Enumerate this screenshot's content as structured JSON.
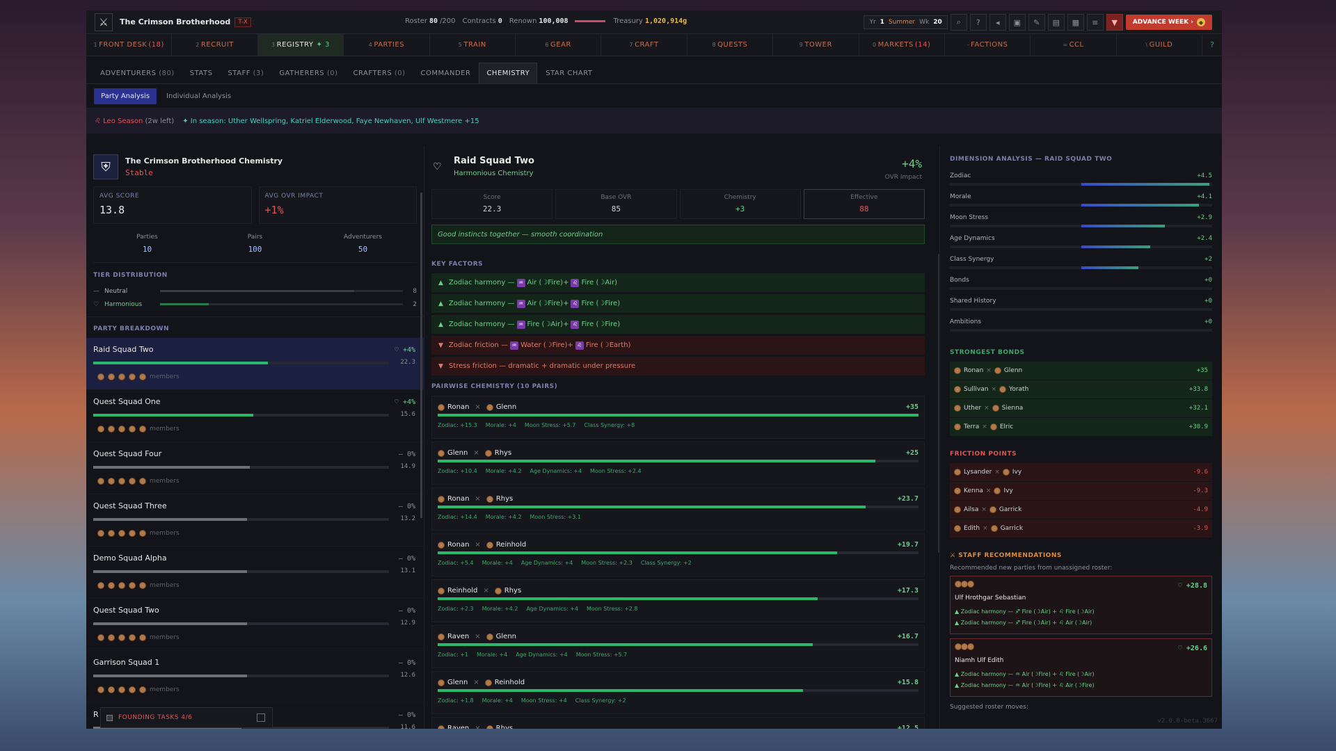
{
  "header": {
    "title": "The Crimson Brotherhood",
    "tag": "T-X",
    "roster_label": "Roster",
    "roster": "80",
    "roster_max": "/200",
    "contracts_label": "Contracts",
    "contracts": "0",
    "renown_label": "Renown",
    "renown": "100,008",
    "treasury_label": "Treasury",
    "treasury": "1,020,914g",
    "yr_label": "Yr",
    "yr": "1",
    "season": "Summer",
    "wk_label": "Wk",
    "wk": "20",
    "advance": "ADVANCE WEEK ›"
  },
  "nav": [
    {
      "n": "1",
      "label": "FRONT DESK",
      "count": "(18)"
    },
    {
      "n": "2",
      "label": "RECRUIT"
    },
    {
      "n": "3",
      "label": "REGISTRY",
      "acc": "✦ 3",
      "active": true
    },
    {
      "n": "4",
      "label": "PARTIES"
    },
    {
      "n": "5",
      "label": "TRAIN"
    },
    {
      "n": "6",
      "label": "GEAR"
    },
    {
      "n": "7",
      "label": "CRAFT"
    },
    {
      "n": "8",
      "label": "QUESTS"
    },
    {
      "n": "9",
      "label": "TOWER"
    },
    {
      "n": "0",
      "label": "MARKETS",
      "count": "(14)"
    },
    {
      "n": "-",
      "label": "FACTIONS"
    },
    {
      "n": "=",
      "label": "CCL"
    },
    {
      "n": "\\",
      "label": "GUILD"
    }
  ],
  "subtabs": [
    {
      "label": "ADVENTURERS",
      "c": "(80)"
    },
    {
      "label": "STATS"
    },
    {
      "label": "STAFF",
      "c": "(3)"
    },
    {
      "label": "GATHERERS",
      "c": "(0)"
    },
    {
      "label": "CRAFTERS",
      "c": "(0)"
    },
    {
      "label": "COMMANDER"
    },
    {
      "label": "CHEMISTRY",
      "active": true
    },
    {
      "label": "STAR CHART"
    }
  ],
  "modes": [
    "Party Analysis",
    "Individual Analysis"
  ],
  "season_bar": {
    "leo": "Leo Season",
    "left": "(2w left)",
    "in_season": "✦ In season: Uther Wellspring, Katriel Elderwood, Faye Newhaven, Ulf Westmere +15"
  },
  "summary": {
    "title": "The Crimson Brotherhood Chemistry",
    "status": "Stable",
    "avg_score_label": "AVG SCORE",
    "avg_score": "13.8",
    "avg_ovr_label": "AVG OVR IMPACT",
    "avg_ovr": "+1%",
    "parties_label": "Parties",
    "parties": "10",
    "pairs_label": "Pairs",
    "pairs": "100",
    "adventurers_label": "Adventurers",
    "adventurers": "50"
  },
  "tier": {
    "header": "TIER DISTRIBUTION",
    "rows": [
      {
        "name": "Neutral",
        "count": "8",
        "frac": 0.8
      },
      {
        "name": "Harmonious",
        "count": "2",
        "frac": 0.2
      }
    ]
  },
  "breakdown": {
    "header": "PARTY BREAKDOWN",
    "members": "members",
    "parties": [
      {
        "name": "Raid Squad Two",
        "impact": "+4%",
        "score": "22.3",
        "frac": 0.59,
        "good": true
      },
      {
        "name": "Quest Squad One",
        "impact": "+4%",
        "score": "15.6",
        "frac": 0.54,
        "good": true
      },
      {
        "name": "Quest Squad Four",
        "impact": "— 0%",
        "score": "14.9",
        "frac": 0.53
      },
      {
        "name": "Quest Squad Three",
        "impact": "— 0%",
        "score": "13.2",
        "frac": 0.52
      },
      {
        "name": "Demo Squad Alpha",
        "impact": "— 0%",
        "score": "13.1",
        "frac": 0.52
      },
      {
        "name": "Quest Squad Two",
        "impact": "— 0%",
        "score": "12.9",
        "frac": 0.52
      },
      {
        "name": "Garrison Squad 1",
        "impact": "— 0%",
        "score": "12.6",
        "frac": 0.52
      },
      {
        "name": "R",
        "impact": "— 0%",
        "score": "11.6",
        "frac": 0.5
      }
    ]
  },
  "founding": "FOUNDING TASKS 4/6",
  "detail": {
    "title": "Raid Squad Two",
    "sub": "Harmonious Chemistry",
    "impact": "+4%",
    "impact_label": "OVR Impact",
    "score_label": "Score",
    "score": "22.3",
    "base_label": "Base OVR",
    "base": "85",
    "chem_label": "Chemistry",
    "chem": "+3",
    "eff_label": "Effective",
    "eff": "88",
    "quote": "Good instincts together — smooth coordination",
    "kf_header": "KEY FACTORS",
    "pair_header": "PAIRWISE CHEMISTRY (10 PAIRS)"
  },
  "key_factors": [
    {
      "up": true,
      "pre": "Zodiac harmony —",
      "a": "Air (☽Fire)",
      "b": "Fire (☽Air)"
    },
    {
      "up": true,
      "pre": "Zodiac harmony —",
      "a": "Air (☽Fire)",
      "b": "Fire (☽Fire)"
    },
    {
      "up": true,
      "pre": "Zodiac harmony —",
      "a": "Fire (☽Air)",
      "b": "Fire (☽Fire)"
    },
    {
      "up": false,
      "pre": "Zodiac friction —",
      "a": "Water (☽Fire)",
      "b": "Fire (☽Earth)"
    },
    {
      "up": false,
      "pre": "Stress friction — dramatic + dramatic under pressure",
      "a": "",
      "b": ""
    }
  ],
  "pairs": [
    {
      "a": "Ronan",
      "b": "Glenn",
      "v": "+35",
      "frac": 1.0,
      "det": [
        "Zodiac: +15.3",
        "Morale: +4",
        "Moon Stress: +5.7",
        "Class Synergy: +8"
      ]
    },
    {
      "a": "Glenn",
      "b": "Rhys",
      "v": "+25",
      "frac": 0.91,
      "det": [
        "Zodiac: +10.4",
        "Morale: +4.2",
        "Age Dynamics: +4",
        "Moon Stress: +2.4"
      ]
    },
    {
      "a": "Ronan",
      "b": "Rhys",
      "v": "+23.7",
      "frac": 0.89,
      "det": [
        "Zodiac: +14.4",
        "Morale: +4.2",
        "Moon Stress: +3.1"
      ]
    },
    {
      "a": "Ronan",
      "b": "Reinhold",
      "v": "+19.7",
      "frac": 0.83,
      "det": [
        "Zodiac: +5.4",
        "Morale: +4",
        "Age Dynamics: +4",
        "Moon Stress: +2.3",
        "Class Synergy: +2"
      ]
    },
    {
      "a": "Reinhold",
      "b": "Rhys",
      "v": "+17.3",
      "frac": 0.79,
      "det": [
        "Zodiac: +2.3",
        "Morale: +4.2",
        "Age Dynamics: +4",
        "Moon Stress: +2.8"
      ]
    },
    {
      "a": "Raven",
      "b": "Glenn",
      "v": "+16.7",
      "frac": 0.78,
      "det": [
        "Zodiac: +1",
        "Morale: +4",
        "Age Dynamics: +4",
        "Moon Stress: +5.7"
      ]
    },
    {
      "a": "Glenn",
      "b": "Reinhold",
      "v": "+15.8",
      "frac": 0.76,
      "det": [
        "Zodiac: +1.8",
        "Morale: +4",
        "Moon Stress: +4",
        "Class Synergy: +2"
      ]
    },
    {
      "a": "Raven",
      "b": "Rhys",
      "v": "+12.5",
      "frac": 0.7,
      "det": []
    }
  ],
  "dimension": {
    "header": "DIMENSION ANALYSIS — RAID SQUAD TWO",
    "rows": [
      {
        "name": "Zodiac",
        "v": "+4.5",
        "frac": 0.98
      },
      {
        "name": "Morale",
        "v": "+4.1",
        "frac": 0.9
      },
      {
        "name": "Moon Stress",
        "v": "+2.9",
        "frac": 0.64
      },
      {
        "name": "Age Dynamics",
        "v": "+2.4",
        "frac": 0.53
      },
      {
        "name": "Class Synergy",
        "v": "+2",
        "frac": 0.44
      },
      {
        "name": "Bonds",
        "v": "+0",
        "frac": 0
      },
      {
        "name": "Shared History",
        "v": "+0",
        "frac": 0
      },
      {
        "name": "Ambitions",
        "v": "+0",
        "frac": 0
      }
    ]
  },
  "bonds": {
    "header": "STRONGEST BONDS",
    "rows": [
      {
        "a": "Ronan",
        "b": "Glenn",
        "v": "+35"
      },
      {
        "a": "Sullivan",
        "b": "Yorath",
        "v": "+33.8"
      },
      {
        "a": "Uther",
        "b": "Sienna",
        "v": "+32.1"
      },
      {
        "a": "Terra",
        "b": "Elric",
        "v": "+30.9"
      }
    ]
  },
  "friction": {
    "header": "FRICTION POINTS",
    "rows": [
      {
        "a": "Lysander",
        "b": "Ivy",
        "v": "-9.6"
      },
      {
        "a": "Kenna",
        "b": "Ivy",
        "v": "-9.3"
      },
      {
        "a": "Ailsa",
        "b": "Garrick",
        "v": "-4.9"
      },
      {
        "a": "Edith",
        "b": "Garrick",
        "v": "-3.9"
      }
    ]
  },
  "recs": {
    "header": "STAFF RECOMMENDATIONS",
    "sub": "Recommended new parties from unassigned roster:",
    "items": [
      {
        "names": "Ulf Hrothgar Sebastian",
        "v": "+28.8",
        "f1": "▲ Zodiac harmony — ♐ Fire (☽Air) + ♌ Fire (☽Air)",
        "f2": "▲ Zodiac harmony — ♐ Fire (☽Air) + ♌ Air (☽Air)"
      },
      {
        "names": "Niamh Ulf Edith",
        "v": "+26.6",
        "f1": "▲ Zodiac harmony — ♒ Air (☽Fire) + ♌ Fire (☽Air)",
        "f2": "▲ Zodiac harmony — ♒ Air (☽Fire) + ♌ Air (☽Fire)"
      }
    ],
    "sugg": "Suggested roster moves:"
  },
  "version": "v2.0.0-beta.3667"
}
